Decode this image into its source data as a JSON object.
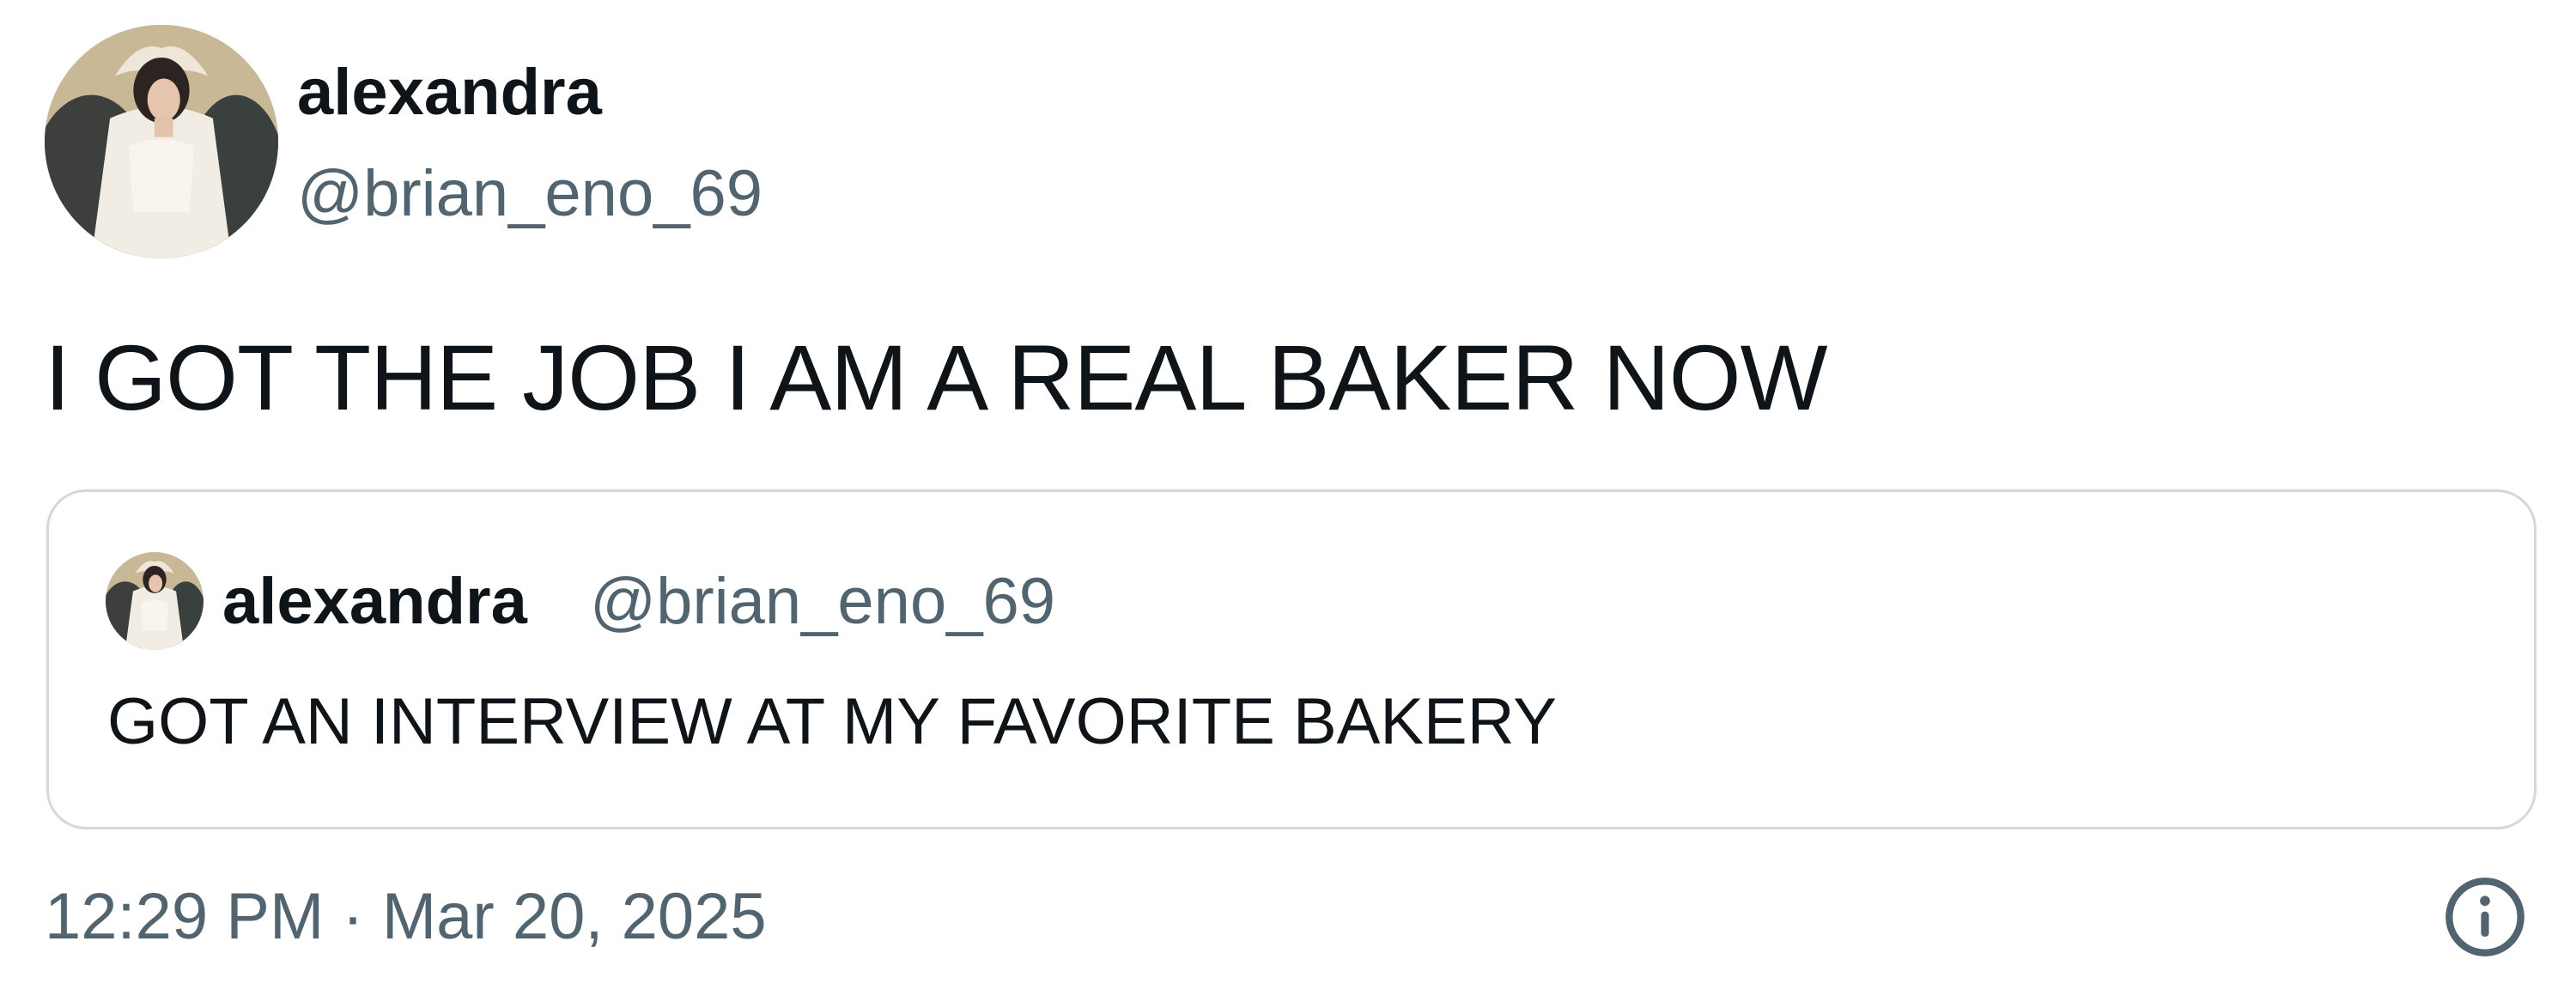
{
  "tweet": {
    "author": {
      "name": "alexandra",
      "handle": "@brian_eno_69",
      "avatar_icon": "portrait-avatar-icon"
    },
    "text": "I GOT THE JOB I AM A REAL BAKER NOW",
    "quoted_tweet": {
      "author_name": "alexandra",
      "author_handle": "@brian_eno_69",
      "avatar_icon": "portrait-avatar-icon",
      "text": "GOT AN INTERVIEW AT MY FAVORITE BAKERY"
    },
    "timestamp": "12:29 PM · Mar 20, 2025",
    "info_icon": "info-circle-icon"
  },
  "colors": {
    "primary_text": "#0f1419",
    "secondary_text": "#536471",
    "border": "#cfd9de",
    "background": "#ffffff"
  }
}
